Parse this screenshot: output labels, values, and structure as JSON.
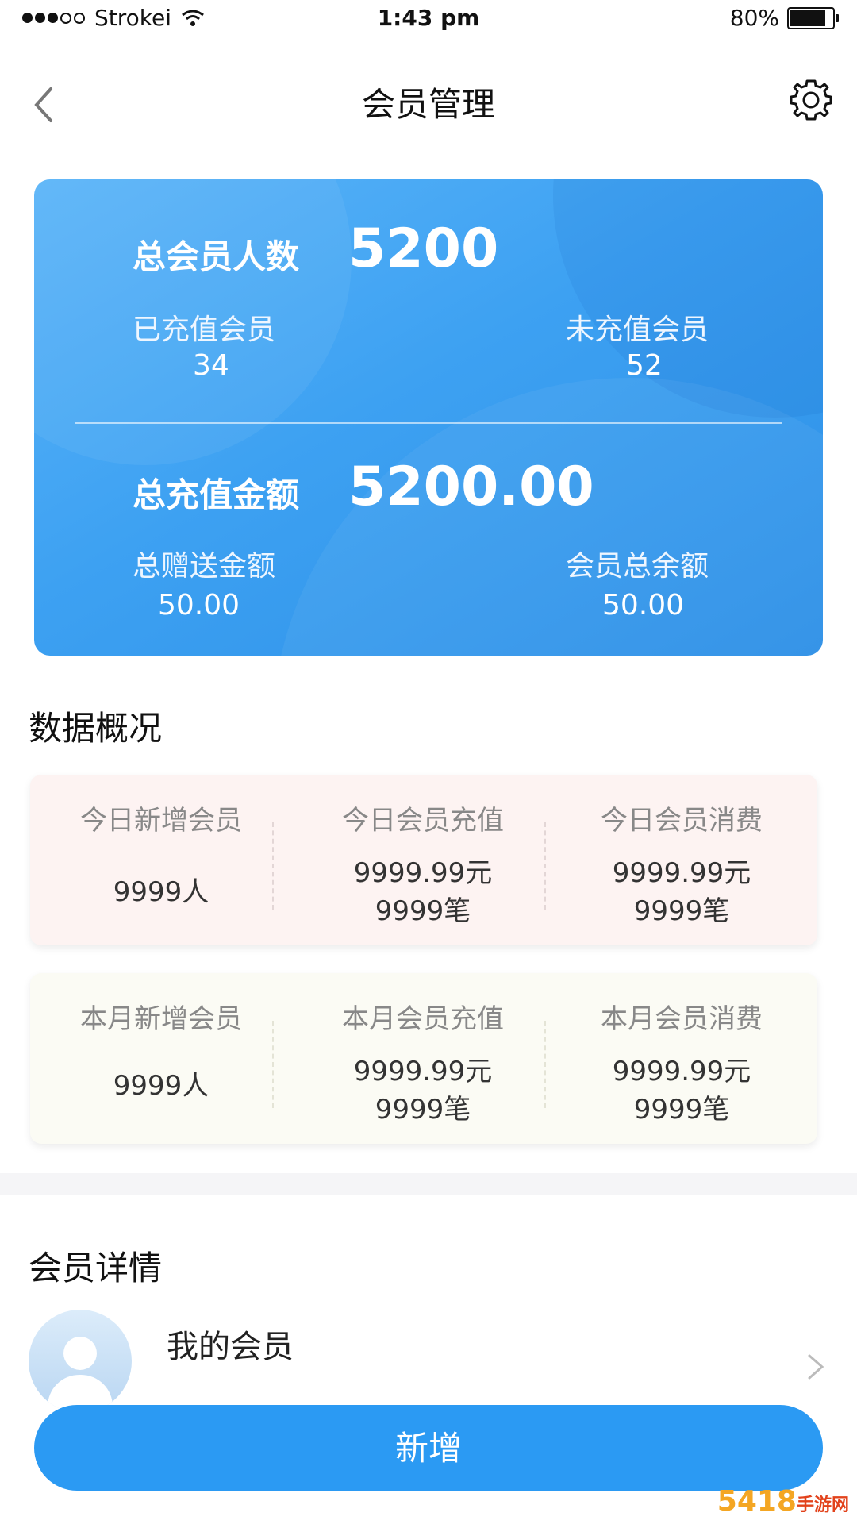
{
  "status_bar": {
    "carrier": "Strokei",
    "time": "1:43 pm",
    "battery": "80%"
  },
  "nav": {
    "title": "会员管理"
  },
  "summary_card": {
    "total_members_label": "总会员人数",
    "total_members_value": "5200",
    "recharged_label": "已充值会员",
    "recharged_value": "34",
    "not_recharged_label": "未充值会员",
    "not_recharged_value": "52",
    "total_recharge_label": "总充值金额",
    "total_recharge_value": "5200.00",
    "total_gift_label": "总赠送金额",
    "total_gift_value": "50.00",
    "member_balance_label": "会员总余额",
    "member_balance_value": "50.00"
  },
  "overview": {
    "title": "数据概况",
    "today": {
      "bg": "#fdf3f2",
      "new_members_label": "今日新增会员",
      "new_members_value": "9999人",
      "recharge_label": "今日会员充值",
      "recharge_amount": "9999.99元",
      "recharge_count": "9999笔",
      "consume_label": "今日会员消费",
      "consume_amount": "9999.99元",
      "consume_count": "9999笔"
    },
    "month": {
      "bg": "#fbfbf4",
      "new_members_label": "本月新增会员",
      "new_members_value": "9999人",
      "recharge_label": "本月会员充值",
      "recharge_amount": "9999.99元",
      "recharge_count": "9999笔",
      "consume_label": "本月会员消费",
      "consume_amount": "9999.99元",
      "consume_count": "9999笔"
    }
  },
  "member_details": {
    "title": "会员详情",
    "my_members_label": "我的会员"
  },
  "add_button": {
    "label": "新增"
  },
  "watermark": {
    "main": "5418",
    "sub": "手游网"
  },
  "colors": {
    "accent": "#2b9af3",
    "card_start": "#5ab4f8",
    "card_end": "#2c8fe6"
  }
}
